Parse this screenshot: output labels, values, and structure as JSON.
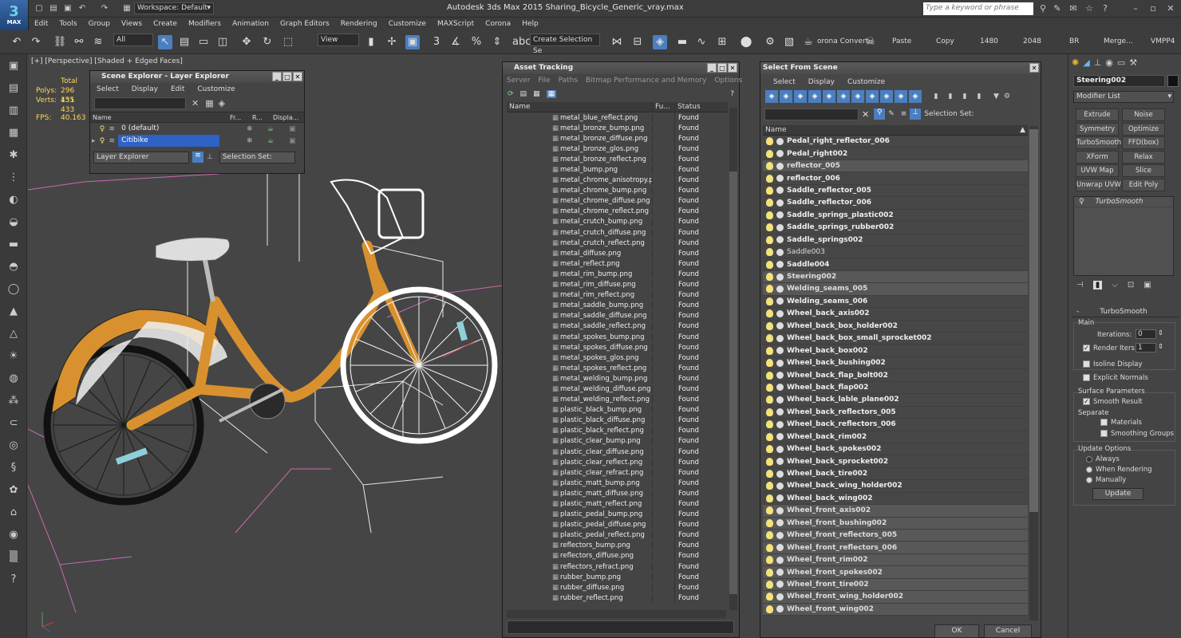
{
  "app": {
    "logo_text": "MAX",
    "title": "Autodesk 3ds Max  2015     Sharing_Bicycle_Generic_vray.max",
    "workspace": "Workspace: Default",
    "search_placeholder": "Type a keyword or phrase"
  },
  "menubar": [
    "Edit",
    "Tools",
    "Group",
    "Views",
    "Create",
    "Modifiers",
    "Animation",
    "Graph Editors",
    "Rendering",
    "Customize",
    "MAXScript",
    "Corona",
    "Help"
  ],
  "toolbar": {
    "selection_filter": "All",
    "ref_coord": "View",
    "selection_set_placeholder": "Create Selection Se",
    "corona_convert": "orona Convert",
    "texts": [
      {
        "id": "paste",
        "label": "Paste"
      },
      {
        "id": "copy",
        "label": "Copy"
      },
      {
        "id": "w1480",
        "label": "1480"
      },
      {
        "id": "w2048",
        "label": "2048"
      },
      {
        "id": "br",
        "label": "BR"
      },
      {
        "id": "merge",
        "label": "Merge..."
      },
      {
        "id": "vmpp4",
        "label": "VMPP4"
      }
    ]
  },
  "viewport": {
    "label": "[+] [Perspective] [Shaded + Edged Faces]",
    "stats": {
      "total_label": "Total",
      "polys_label": "Polys:",
      "polys": "296 435",
      "verts_label": "Verts:",
      "verts": "151 433",
      "fps_label": "FPS:",
      "fps": "40.163"
    }
  },
  "scene_explorer": {
    "title": "Scene Explorer - Layer Explorer",
    "menu": [
      "Select",
      "Display",
      "Edit",
      "Customize"
    ],
    "columns": [
      "Name",
      "Fr...",
      "R...",
      "Displa..."
    ],
    "rows": [
      {
        "name": "0 (default)",
        "selected": false
      },
      {
        "name": "Citibike",
        "selected": true
      }
    ],
    "footer_explorer": "Layer Explorer",
    "footer_selset": "Selection Set:"
  },
  "asset_tracking": {
    "title": "Asset Tracking",
    "menu": [
      "Server",
      "File",
      "Paths",
      "Bitmap Performance and Memory",
      "Options"
    ],
    "columns": {
      "name": "Name",
      "fu": "Fu...",
      "status": "Status"
    },
    "rows": [
      {
        "name": "metal_blue_reflect.png",
        "status": "Found"
      },
      {
        "name": "metal_bronze_bump.png",
        "status": "Found"
      },
      {
        "name": "metal_bronze_diffuse.png",
        "status": "Found"
      },
      {
        "name": "metal_bronze_glos.png",
        "status": "Found"
      },
      {
        "name": "metal_bronze_reflect.png",
        "status": "Found"
      },
      {
        "name": "metal_bump.png",
        "status": "Found"
      },
      {
        "name": "metal_chrome_anisotropy.png",
        "status": "Found"
      },
      {
        "name": "metal_chrome_bump.png",
        "status": "Found"
      },
      {
        "name": "metal_chrome_diffuse.png",
        "status": "Found"
      },
      {
        "name": "metal_chrome_reflect.png",
        "status": "Found"
      },
      {
        "name": "metal_crutch_bump.png",
        "status": "Found"
      },
      {
        "name": "metal_crutch_diffuse.png",
        "status": "Found"
      },
      {
        "name": "metal_crutch_reflect.png",
        "status": "Found"
      },
      {
        "name": "metal_diffuse.png",
        "status": "Found"
      },
      {
        "name": "metal_reflect.png",
        "status": "Found"
      },
      {
        "name": "metal_rim_bump.png",
        "status": "Found"
      },
      {
        "name": "metal_rim_diffuse.png",
        "status": "Found"
      },
      {
        "name": "metal_rim_reflect.png",
        "status": "Found"
      },
      {
        "name": "metal_saddle_bump.png",
        "status": "Found"
      },
      {
        "name": "metal_saddle_diffuse.png",
        "status": "Found"
      },
      {
        "name": "metal_saddle_reflect.png",
        "status": "Found"
      },
      {
        "name": "metal_spokes_bump.png",
        "status": "Found"
      },
      {
        "name": "metal_spokes_diffuse.png",
        "status": "Found"
      },
      {
        "name": "metal_spokes_glos.png",
        "status": "Found"
      },
      {
        "name": "metal_spokes_reflect.png",
        "status": "Found"
      },
      {
        "name": "metal_welding_bump.png",
        "status": "Found"
      },
      {
        "name": "metal_welding_diffuse.png",
        "status": "Found"
      },
      {
        "name": "metal_welding_reflect.png",
        "status": "Found"
      },
      {
        "name": "plastic_black_bump.png",
        "status": "Found"
      },
      {
        "name": "plastic_black_diffuse.png",
        "status": "Found"
      },
      {
        "name": "plastic_black_reflect.png",
        "status": "Found"
      },
      {
        "name": "plastic_clear_bump.png",
        "status": "Found"
      },
      {
        "name": "plastic_clear_diffuse.png",
        "status": "Found"
      },
      {
        "name": "plastic_clear_reflect.png",
        "status": "Found"
      },
      {
        "name": "plastic_clear_refract.png",
        "status": "Found"
      },
      {
        "name": "plastic_matt_bump.png",
        "status": "Found"
      },
      {
        "name": "plastic_matt_diffuse.png",
        "status": "Found"
      },
      {
        "name": "plastic_matt_reflect.png",
        "status": "Found"
      },
      {
        "name": "plastic_pedal_bump.png",
        "status": "Found"
      },
      {
        "name": "plastic_pedal_diffuse.png",
        "status": "Found"
      },
      {
        "name": "plastic_pedal_reflect.png",
        "status": "Found"
      },
      {
        "name": "reflectors_bump.png",
        "status": "Found"
      },
      {
        "name": "reflectors_diffuse.png",
        "status": "Found"
      },
      {
        "name": "reflectors_refract.png",
        "status": "Found"
      },
      {
        "name": "rubber_bump.png",
        "status": "Found"
      },
      {
        "name": "rubber_diffuse.png",
        "status": "Found"
      },
      {
        "name": "rubber_reflect.png",
        "status": "Found"
      }
    ]
  },
  "select_from_scene": {
    "title": "Select From Scene",
    "menu": [
      "Select",
      "Display",
      "Customize"
    ],
    "selection_set_label": "Selection Set:",
    "column_name": "Name",
    "ok_label": "OK",
    "cancel_label": "Cancel",
    "rows": [
      {
        "name": "Pedal_right_reflector_006",
        "state": "normal"
      },
      {
        "name": "Pedal_right002",
        "state": "normal"
      },
      {
        "name": "reflector_005",
        "state": "sel"
      },
      {
        "name": "reflector_006",
        "state": "normal"
      },
      {
        "name": "Saddle_reflector_005",
        "state": "normal"
      },
      {
        "name": "Saddle_reflector_006",
        "state": "normal"
      },
      {
        "name": "Saddle_springs_plastic002",
        "state": "normal"
      },
      {
        "name": "Saddle_springs_rubber002",
        "state": "normal"
      },
      {
        "name": "Saddle_springs002",
        "state": "normal"
      },
      {
        "name": "Saddle003",
        "state": "dim"
      },
      {
        "name": "Saddle004",
        "state": "normal"
      },
      {
        "name": "Steering002",
        "state": "sel"
      },
      {
        "name": "Welding_seams_005",
        "state": "sel"
      },
      {
        "name": "Welding_seams_006",
        "state": "normal"
      },
      {
        "name": "Wheel_back_axis002",
        "state": "normal"
      },
      {
        "name": "Wheel_back_box_holder002",
        "state": "normal"
      },
      {
        "name": "Wheel_back_box_small_sprocket002",
        "state": "normal"
      },
      {
        "name": "Wheel_back_box002",
        "state": "normal"
      },
      {
        "name": "Wheel_back_bushing002",
        "state": "normal"
      },
      {
        "name": "Wheel_back_flap_bolt002",
        "state": "normal"
      },
      {
        "name": "Wheel_back_flap002",
        "state": "normal"
      },
      {
        "name": "Wheel_back_lable_plane002",
        "state": "normal"
      },
      {
        "name": "Wheel_back_reflectors_005",
        "state": "normal"
      },
      {
        "name": "Wheel_back_reflectors_006",
        "state": "normal"
      },
      {
        "name": "Wheel_back_rim002",
        "state": "normal"
      },
      {
        "name": "Wheel_back_spokes002",
        "state": "normal"
      },
      {
        "name": "Wheel_back_sprocket002",
        "state": "normal"
      },
      {
        "name": "Wheel_back_tire002",
        "state": "normal"
      },
      {
        "name": "Wheel_back_wing_holder002",
        "state": "normal"
      },
      {
        "name": "Wheel_back_wing002",
        "state": "normal"
      },
      {
        "name": "Wheel_front_axis002",
        "state": "sel"
      },
      {
        "name": "Wheel_front_bushing002",
        "state": "sel"
      },
      {
        "name": "Wheel_front_reflectors_005",
        "state": "sel"
      },
      {
        "name": "Wheel_front_reflectors_006",
        "state": "sel"
      },
      {
        "name": "Wheel_front_rim002",
        "state": "sel"
      },
      {
        "name": "Wheel_front_spokes002",
        "state": "sel"
      },
      {
        "name": "Wheel_front_tire002",
        "state": "sel"
      },
      {
        "name": "Wheel_front_wing_holder002",
        "state": "sel"
      },
      {
        "name": "Wheel_front_wing002",
        "state": "sel"
      }
    ]
  },
  "command_panel": {
    "object_name": "Steering002",
    "modifier_list": "Modifier List",
    "modifier_buttons": [
      "Extrude",
      "Noise",
      "Symmetry",
      "Optimize",
      "TurboSmooth",
      "FFD(box)",
      "XForm",
      "Relax",
      "UVW Map",
      "Slice",
      "Unwrap UVW",
      "Edit Poly"
    ],
    "stack_item": "TurboSmooth",
    "rollout_title": "TurboSmooth",
    "main_label": "Main",
    "iterations_label": "Iterations:",
    "iterations_value": "0",
    "render_iters_label": "Render Iters:",
    "render_iters_value": "1",
    "isoline_label": "Isoline Display",
    "explicit_normals_label": "Explicit Normals",
    "surface_params_label": "Surface Parameters",
    "smooth_result_label": "Smooth Result",
    "separate_label": "Separate",
    "materials_label": "Materials",
    "smoothing_groups_label": "Smoothing Groups",
    "update_options_label": "Update Options",
    "always_label": "Always",
    "when_rendering_label": "When Rendering",
    "manually_label": "Manually",
    "update_button": "Update"
  },
  "colors": {
    "accent": "#2e62c4",
    "bike_orange": "#d8912e",
    "bulb": "#f4e27a",
    "stat_text": "#ffd75a"
  }
}
